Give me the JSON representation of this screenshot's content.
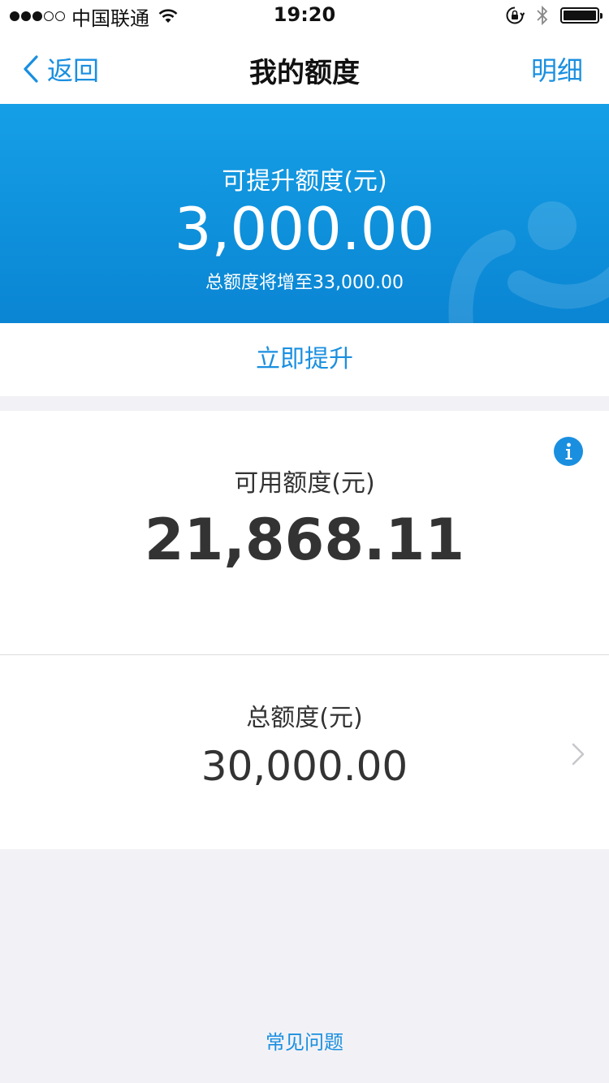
{
  "status_bar": {
    "carrier": "中国联通",
    "time": "19:20",
    "signal_bars_filled": 3,
    "signal_bars_total": 5,
    "battery_level": 1.0
  },
  "nav": {
    "back_label": "返回",
    "title": "我的额度",
    "detail_label": "明细"
  },
  "upgrade_banner": {
    "label": "可提升额度(元)",
    "amount": "3,000.00",
    "subtitle": "总额度将增至33,000.00"
  },
  "upgrade_button_label": "立即提升",
  "available": {
    "label": "可用额度(元)",
    "amount": "21,868.11"
  },
  "total": {
    "label": "总额度(元)",
    "amount": "30,000.00"
  },
  "faq_label": "常见问题",
  "icons": {
    "back": "chevron-left-icon",
    "info": "info-icon",
    "row_arrow": "chevron-right-icon",
    "wifi": "wifi-icon",
    "orientation_lock": "orientation-lock-icon",
    "bluetooth": "bluetooth-icon"
  },
  "colors": {
    "accent": "#1a8fe0",
    "banner_top": "#159fe6",
    "banner_bottom": "#0a85d3",
    "background": "#f2f2f6"
  }
}
